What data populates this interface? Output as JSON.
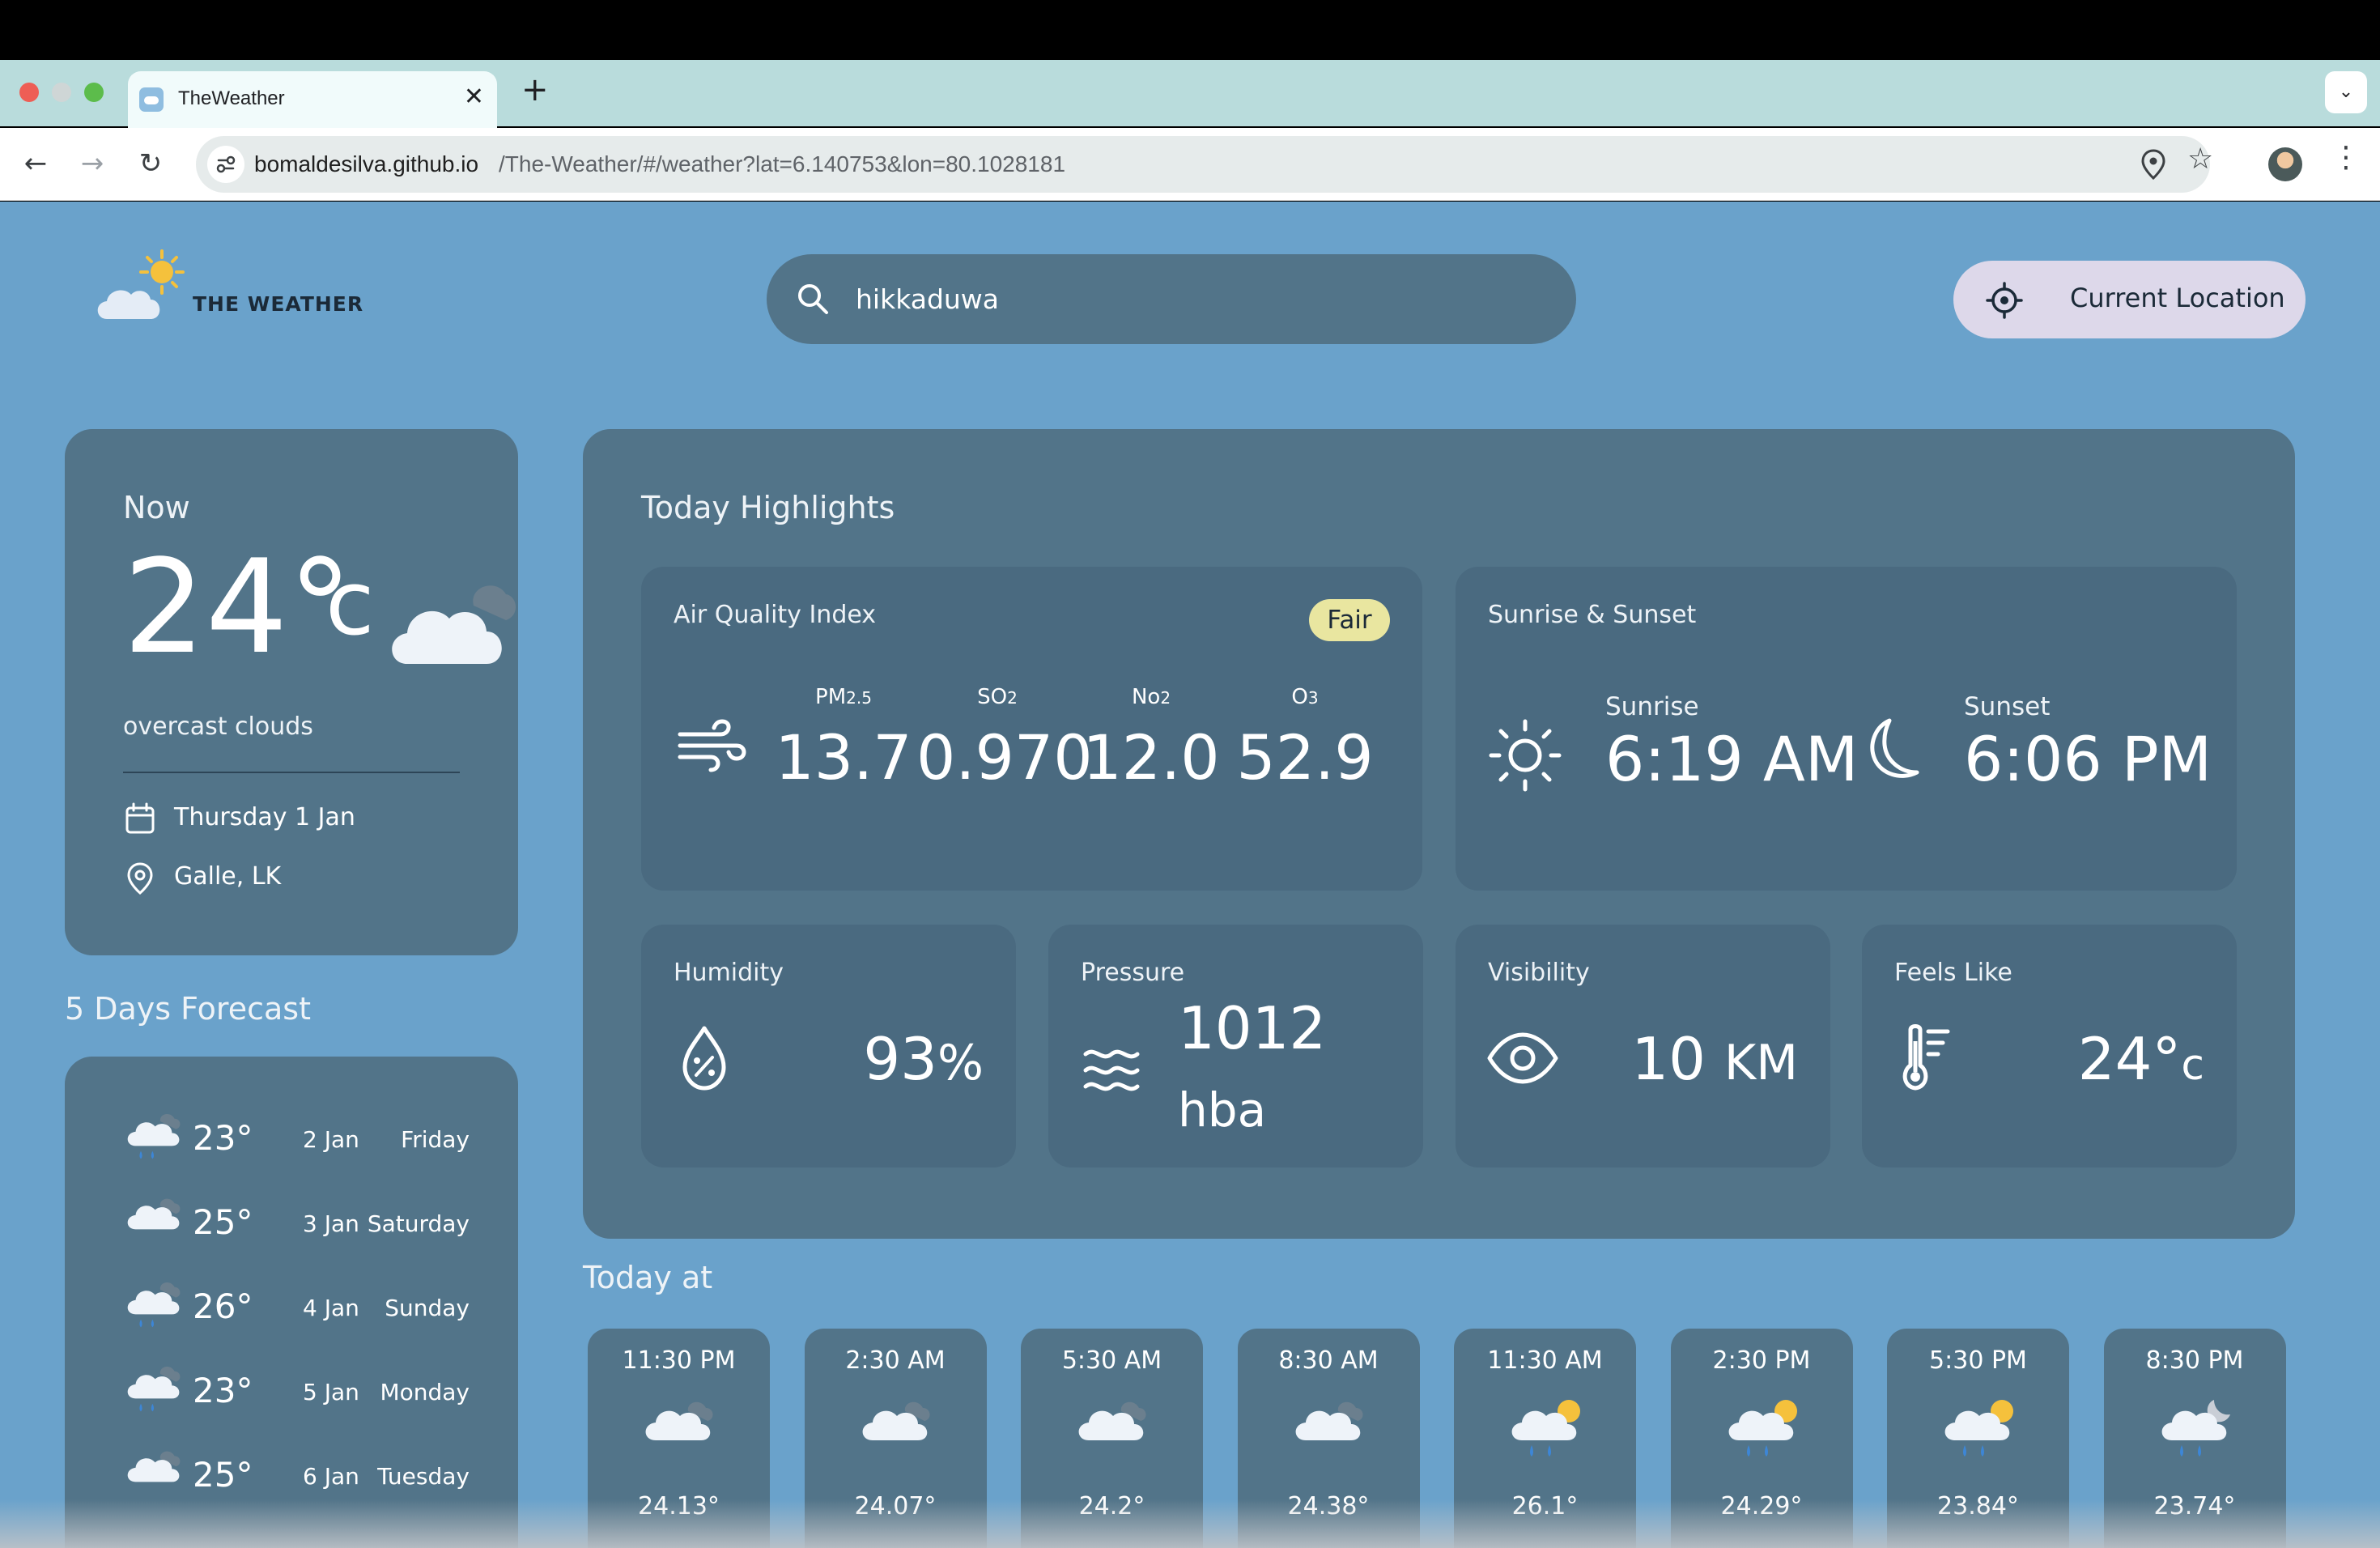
{
  "browser": {
    "tab_title": "TheWeather",
    "tab_close": "✕",
    "new_tab": "+",
    "tab_menu": "⌄",
    "url_host": "bomaldesilva.github.io",
    "url_path": "/The-Weather/#/weather?lat=6.140753&lon=80.1028181"
  },
  "header": {
    "logo_text": "THE WEATHER",
    "search_value": "hikkaduwa",
    "current_location_label": "Current Location"
  },
  "now": {
    "title": "Now",
    "temp": "24°",
    "unit": "c",
    "icon": "overcast-clouds-icon",
    "description": "overcast clouds",
    "date": "Thursday 1 Jan",
    "location": "Galle, LK"
  },
  "forecast": {
    "title": "5 Days Forecast",
    "items": [
      {
        "icon": "rain-cloud-icon",
        "temp": "23°",
        "date": "2 Jan",
        "day": "Friday"
      },
      {
        "icon": "cloud-icon",
        "temp": "25°",
        "date": "3 Jan",
        "day": "Saturday"
      },
      {
        "icon": "rain-cloud-icon",
        "temp": "26°",
        "date": "4 Jan",
        "day": "Sunday"
      },
      {
        "icon": "rain-cloud-icon",
        "temp": "23°",
        "date": "5 Jan",
        "day": "Monday"
      },
      {
        "icon": "cloud-icon",
        "temp": "25°",
        "date": "6 Jan",
        "day": "Tuesday"
      }
    ]
  },
  "highlights": {
    "title": "Today Highlights",
    "aqi": {
      "title": "Air Quality Index",
      "badge": "Fair",
      "items": [
        {
          "label": "PM",
          "sub": "2.5",
          "value": "13.7"
        },
        {
          "label": "SO",
          "sub": "2",
          "value": "0.970"
        },
        {
          "label": "No",
          "sub": "2",
          "value": "12.0"
        },
        {
          "label": "O",
          "sub": "3",
          "value": "52.9"
        }
      ]
    },
    "sun": {
      "title": "Sunrise & Sunset",
      "sunrise_label": "Sunrise",
      "sunrise_value": "6:19 AM",
      "sunset_label": "Sunset",
      "sunset_value": "6:06 PM"
    },
    "humidity": {
      "title": "Humidity",
      "value": "93",
      "unit": "%"
    },
    "pressure": {
      "title": "Pressure",
      "value": "1012",
      "unit": "hba"
    },
    "visibility": {
      "title": "Visibility",
      "value": "10",
      "unit": "KM"
    },
    "feels_like": {
      "title": "Feels Like",
      "value": "24°",
      "unit": "c"
    }
  },
  "today": {
    "title": "Today at",
    "hours": [
      {
        "time": "11:30 PM",
        "icon": "night-cloud-icon",
        "temp": "24.13°"
      },
      {
        "time": "2:30 AM",
        "icon": "night-cloud-icon",
        "temp": "24.07°"
      },
      {
        "time": "5:30 AM",
        "icon": "night-cloud-icon",
        "temp": "24.2°"
      },
      {
        "time": "8:30 AM",
        "icon": "night-cloud-icon",
        "temp": "24.38°"
      },
      {
        "time": "11:30 AM",
        "icon": "sun-rain-cloud-icon",
        "temp": "26.1°"
      },
      {
        "time": "2:30 PM",
        "icon": "sun-rain-cloud-icon",
        "temp": "24.29°"
      },
      {
        "time": "5:30 PM",
        "icon": "sun-rain-cloud-icon",
        "temp": "23.84°"
      },
      {
        "time": "8:30 PM",
        "icon": "night-rain-cloud-icon",
        "temp": "23.74°"
      }
    ]
  },
  "colors": {
    "page_bg": "#6aa2cb",
    "card_bg": "#527489",
    "inner_card_bg": "#4a6a80",
    "badge_fair": "#e9e6a0",
    "location_button": "#ddd8ea",
    "sun_yellow": "#f5c13c"
  }
}
